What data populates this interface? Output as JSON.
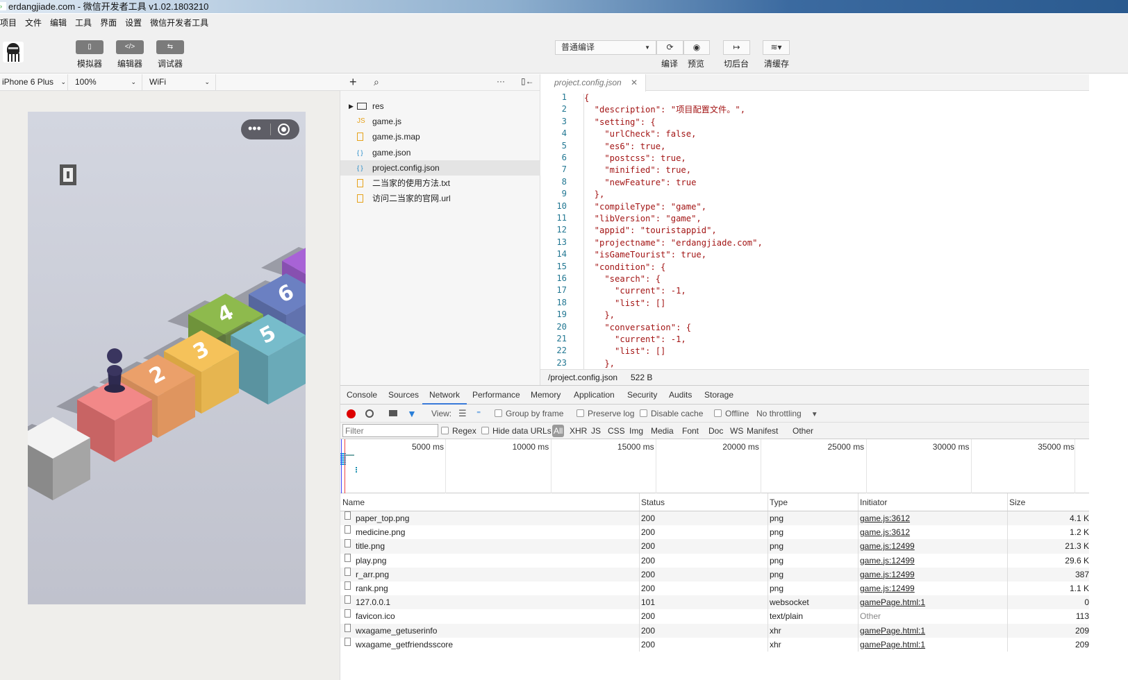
{
  "window": {
    "title": "erdangjiade.com - 微信开发者工具 v1.02.1803210"
  },
  "menu": [
    "项目",
    "文件",
    "编辑",
    "工具",
    "界面",
    "设置",
    "微信开发者工具"
  ],
  "toolbar": {
    "simulator": "模拟器",
    "editor": "编辑器",
    "debugger": "调试器",
    "compile_mode": "普通编译",
    "compile": "编译",
    "preview": "预览",
    "background": "切后台",
    "clear_cache": "清缓存"
  },
  "simbar": {
    "device": "iPhone 6 Plus",
    "zoom": "100%",
    "network": "WiFi"
  },
  "game": {
    "blocks": [
      "2",
      "3",
      "4",
      "5",
      "6"
    ]
  },
  "filetree": {
    "items": [
      {
        "name": "res",
        "type": "folder"
      },
      {
        "name": "game.js",
        "type": "js"
      },
      {
        "name": "game.js.map",
        "type": "file"
      },
      {
        "name": "game.json",
        "type": "json"
      },
      {
        "name": "project.config.json",
        "type": "json",
        "selected": true
      },
      {
        "name": "二当家的使用方法.txt",
        "type": "file"
      },
      {
        "name": "访问二当家的官网.url",
        "type": "file"
      }
    ]
  },
  "editor": {
    "tab": "project.config.json",
    "lines": [
      "{",
      "  \"description\": \"项目配置文件。\",",
      "  \"setting\": {",
      "    \"urlCheck\": false,",
      "    \"es6\": true,",
      "    \"postcss\": true,",
      "    \"minified\": true,",
      "    \"newFeature\": true",
      "  },",
      "  \"compileType\": \"game\",",
      "  \"libVersion\": \"game\",",
      "  \"appid\": \"touristappid\",",
      "  \"projectname\": \"erdangjiade.com\",",
      "  \"isGameTourist\": true,",
      "  \"condition\": {",
      "    \"search\": {",
      "      \"current\": -1,",
      "      \"list\": []",
      "    },",
      "    \"conversation\": {",
      "      \"current\": -1,",
      "      \"list\": []",
      "    },"
    ],
    "status_path": "/project.config.json",
    "status_size": "522 B"
  },
  "devtools": {
    "tabs": [
      "Console",
      "Sources",
      "Network",
      "Performance",
      "Memory",
      "Application",
      "Security",
      "Audits",
      "Storage"
    ],
    "active_tab": "Network",
    "toolbar": {
      "view": "View:",
      "group_by_frame": "Group by frame",
      "preserve_log": "Preserve log",
      "disable_cache": "Disable cache",
      "offline": "Offline",
      "throttling": "No throttling"
    },
    "filter": {
      "placeholder": "Filter",
      "regex": "Regex",
      "hide_data_urls": "Hide data URLs",
      "types": [
        "All",
        "XHR",
        "JS",
        "CSS",
        "Img",
        "Media",
        "Font",
        "Doc",
        "WS",
        "Manifest",
        "Other"
      ]
    },
    "timeline_ticks": [
      "5000 ms",
      "10000 ms",
      "15000 ms",
      "20000 ms",
      "25000 ms",
      "30000 ms",
      "35000 ms"
    ],
    "columns": [
      "Name",
      "Status",
      "Type",
      "Initiator",
      "Size"
    ],
    "rows": [
      [
        "paper_top.png",
        "200",
        "png",
        "game.js:3612",
        "4.1 K"
      ],
      [
        "medicine.png",
        "200",
        "png",
        "game.js:3612",
        "1.2 K"
      ],
      [
        "title.png",
        "200",
        "png",
        "game.js:12499",
        "21.3 K"
      ],
      [
        "play.png",
        "200",
        "png",
        "game.js:12499",
        "29.6 K"
      ],
      [
        "r_arr.png",
        "200",
        "png",
        "game.js:12499",
        "387"
      ],
      [
        "rank.png",
        "200",
        "png",
        "game.js:12499",
        "1.1 K"
      ],
      [
        "127.0.0.1",
        "101",
        "websocket",
        "gamePage.html:1",
        "0"
      ],
      [
        "favicon.ico",
        "200",
        "text/plain",
        "Other",
        "113"
      ],
      [
        "wxagame_getuserinfo",
        "200",
        "xhr",
        "gamePage.html:1",
        "209"
      ],
      [
        "wxagame_getfriendsscore",
        "200",
        "xhr",
        "gamePage.html:1",
        "209"
      ]
    ]
  }
}
